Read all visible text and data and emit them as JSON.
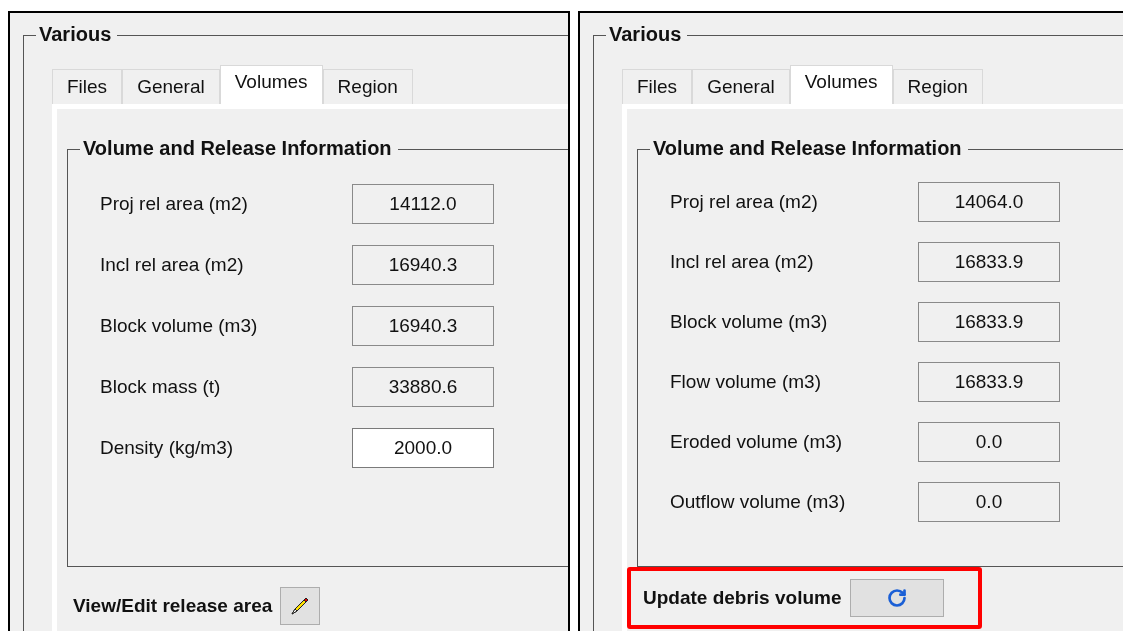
{
  "panels": [
    {
      "group_title": "Various",
      "tabs": [
        {
          "label": "Files",
          "selected": false
        },
        {
          "label": "General",
          "selected": false
        },
        {
          "label": "Volumes",
          "selected": true
        },
        {
          "label": "Region",
          "selected": false
        }
      ],
      "section_title": "Volume and Release Information",
      "fields": [
        {
          "label": "Proj rel area (m2)",
          "value": "14112.0",
          "editable": false
        },
        {
          "label": "Incl rel area (m2)",
          "value": "16940.3",
          "editable": false
        },
        {
          "label": "Block volume (m3)",
          "value": "16940.3",
          "editable": false
        },
        {
          "label": "Block mass (t)",
          "value": "33880.6",
          "editable": false
        },
        {
          "label": "Density (kg/m3)",
          "value": "2000.0",
          "editable": true
        }
      ],
      "action": {
        "label": "View/Edit release area",
        "kind": "edit",
        "highlighted": false
      }
    },
    {
      "group_title": "Various",
      "tabs": [
        {
          "label": "Files",
          "selected": false
        },
        {
          "label": "General",
          "selected": false
        },
        {
          "label": "Volumes",
          "selected": true
        },
        {
          "label": "Region",
          "selected": false
        }
      ],
      "section_title": "Volume and Release Information",
      "fields": [
        {
          "label": "Proj rel area (m2)",
          "value": "14064.0",
          "editable": false
        },
        {
          "label": "Incl rel area (m2)",
          "value": "16833.9",
          "editable": false
        },
        {
          "label": "Block volume (m3)",
          "value": "16833.9",
          "editable": false
        },
        {
          "label": "Flow volume (m3)",
          "value": "16833.9",
          "editable": false
        },
        {
          "label": "Eroded volume (m3)",
          "value": "0.0",
          "editable": false
        },
        {
          "label": "Outflow volume (m3)",
          "value": "0.0",
          "editable": false
        }
      ],
      "action": {
        "label": "Update debris volume",
        "kind": "refresh",
        "highlighted": true
      }
    }
  ]
}
